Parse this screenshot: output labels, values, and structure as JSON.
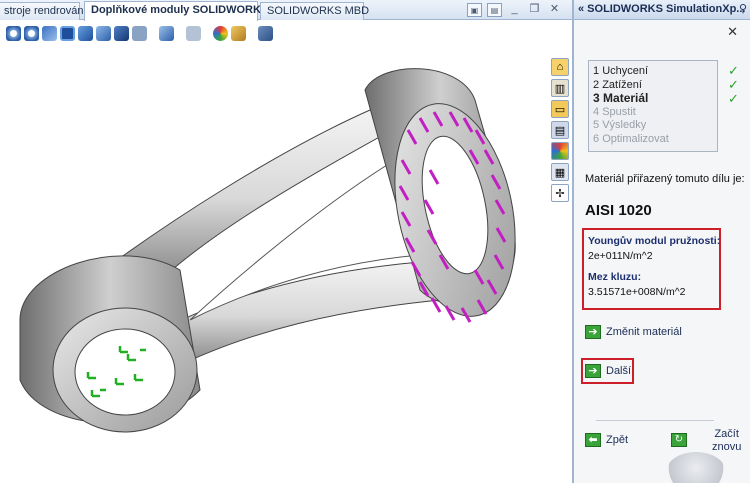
{
  "tabs": [
    {
      "label": "stroje rendrování"
    },
    {
      "label": "Doplňkové moduly SOLIDWORKS"
    },
    {
      "label": "SOLIDWORKS MBD"
    }
  ],
  "panel": {
    "title": "« SOLIDWORKS SimulationXp...",
    "steps": [
      {
        "num": "1",
        "label": "Uchycení"
      },
      {
        "num": "2",
        "label": "Zatížení"
      },
      {
        "num": "3",
        "label": "Materiál"
      },
      {
        "num": "4",
        "label": "Spustit"
      },
      {
        "num": "5",
        "label": "Výsledky"
      },
      {
        "num": "6",
        "label": "Optimalizovat"
      }
    ],
    "material_label": "Materiál přiřazený tomuto dílu je:",
    "material_name": "AISI 1020",
    "youngs_label": "Youngův modul pružnosti:",
    "youngs_value": "2e+011N/m^2",
    "yield_label": "Mez kluzu:",
    "yield_value": "3.51571e+008N/m^2",
    "change_material": "Změnit materiál",
    "next": "Další",
    "back": "Zpět",
    "restart_line1": "Začít",
    "restart_line2": "znovu"
  },
  "colors": {
    "accent_red": "#cc1f2a",
    "load_arrows": "#c21fc2",
    "fixture_arrows": "#22b022",
    "check": "#2aa22a"
  },
  "icons": [
    "home-icon",
    "resources-icon",
    "folder-icon",
    "view-palette-icon",
    "appearances-icon",
    "custom-properties-icon",
    "simulationxpress-icon"
  ]
}
